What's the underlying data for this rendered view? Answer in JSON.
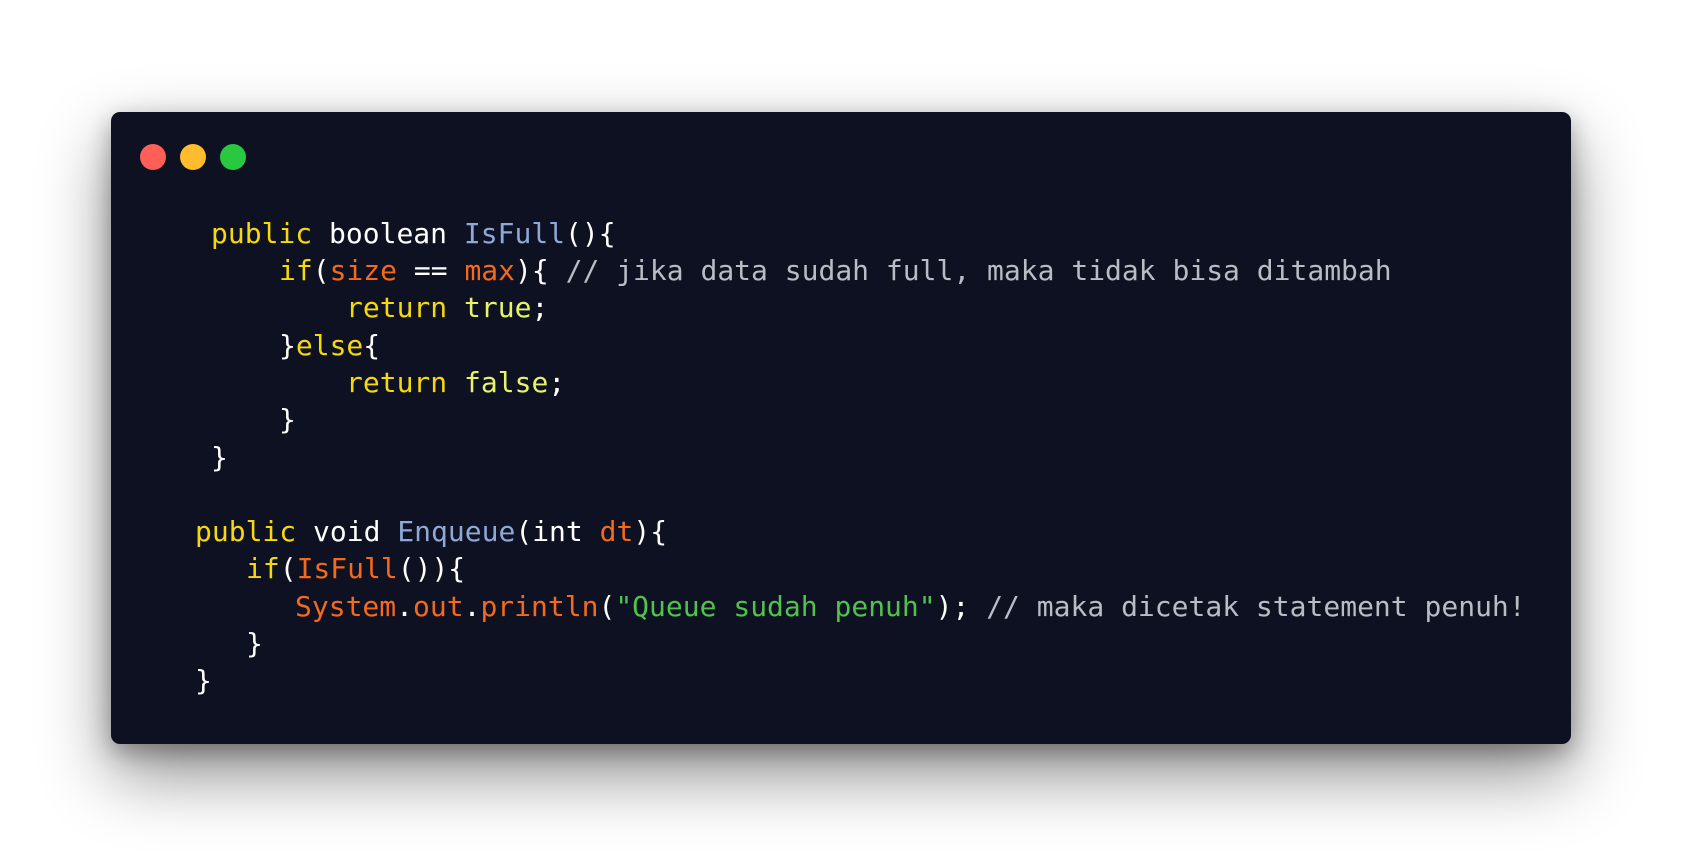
{
  "window": {
    "controls": [
      {
        "name": "close",
        "color": "#ff5f57"
      },
      {
        "name": "minimize",
        "color": "#febc2e"
      },
      {
        "name": "zoom",
        "color": "#28c840"
      }
    ],
    "background": "#0e1121"
  },
  "theme": {
    "keyword": "#f5d90a",
    "plain": "#ffffff",
    "function": "#8fa8d6",
    "variable": "#f36a1c",
    "boolean": "#e6f26c",
    "comment": "#b9bcc4",
    "string": "#50c24d"
  },
  "code": {
    "lines": [
      [
        {
          "t": "public",
          "k": "keyword"
        },
        {
          "t": " ",
          "k": "plain"
        },
        {
          "t": "boolean",
          "k": "plain"
        },
        {
          "t": " ",
          "k": "plain"
        },
        {
          "t": "IsFull",
          "k": "function"
        },
        {
          "t": "(){",
          "k": "plain"
        }
      ],
      [
        {
          "t": "if",
          "k": "keyword"
        },
        {
          "t": "(",
          "k": "plain"
        },
        {
          "t": "size",
          "k": "variable"
        },
        {
          "t": " == ",
          "k": "plain"
        },
        {
          "t": "max",
          "k": "variable"
        },
        {
          "t": "){ ",
          "k": "plain"
        },
        {
          "t": "// jika data sudah full, maka tidak bisa ditambah",
          "k": "comment"
        }
      ],
      [
        {
          "t": "return",
          "k": "keyword"
        },
        {
          "t": " ",
          "k": "plain"
        },
        {
          "t": "true",
          "k": "boolean"
        },
        {
          "t": ";",
          "k": "plain"
        }
      ],
      [
        {
          "t": "}",
          "k": "plain"
        },
        {
          "t": "else",
          "k": "keyword"
        },
        {
          "t": "{",
          "k": "plain"
        }
      ],
      [
        {
          "t": "return",
          "k": "keyword"
        },
        {
          "t": " ",
          "k": "plain"
        },
        {
          "t": "false",
          "k": "boolean"
        },
        {
          "t": ";",
          "k": "plain"
        }
      ],
      [
        {
          "t": "}",
          "k": "plain"
        }
      ],
      [
        {
          "t": "}",
          "k": "plain"
        }
      ],
      [
        {
          "t": "public",
          "k": "keyword"
        },
        {
          "t": " ",
          "k": "plain"
        },
        {
          "t": "void",
          "k": "plain"
        },
        {
          "t": " ",
          "k": "plain"
        },
        {
          "t": "Enqueue",
          "k": "function"
        },
        {
          "t": "(",
          "k": "plain"
        },
        {
          "t": "int",
          "k": "plain"
        },
        {
          "t": " ",
          "k": "plain"
        },
        {
          "t": "dt",
          "k": "variable"
        },
        {
          "t": "){",
          "k": "plain"
        }
      ],
      [
        {
          "t": "if",
          "k": "keyword"
        },
        {
          "t": "(",
          "k": "plain"
        },
        {
          "t": "IsFull",
          "k": "variable"
        },
        {
          "t": "()){",
          "k": "plain"
        }
      ],
      [
        {
          "t": "System",
          "k": "variable"
        },
        {
          "t": ".",
          "k": "plain"
        },
        {
          "t": "out",
          "k": "variable"
        },
        {
          "t": ".",
          "k": "plain"
        },
        {
          "t": "println",
          "k": "variable"
        },
        {
          "t": "(",
          "k": "plain"
        },
        {
          "t": "\"Queue sudah penuh\"",
          "k": "string"
        },
        {
          "t": "); ",
          "k": "plain"
        },
        {
          "t": "// maka dicetak statement penuh!",
          "k": "comment"
        }
      ],
      [
        {
          "t": "}",
          "k": "plain"
        }
      ],
      [
        {
          "t": "}",
          "k": "plain"
        }
      ]
    ]
  }
}
